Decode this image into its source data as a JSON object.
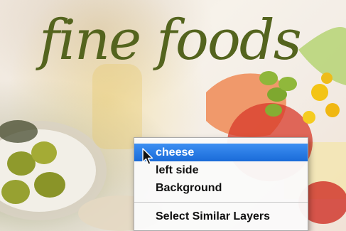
{
  "image": {
    "watermark_text": "fine foods",
    "colors": {
      "watermark": "#54641e",
      "menu_background": "#fafafa",
      "menu_selection": "#2a7ce6",
      "menu_text": "#101010"
    }
  },
  "context_menu": {
    "items": [
      {
        "label": "cheese",
        "selected": true
      },
      {
        "label": "left side",
        "selected": false
      },
      {
        "label": "Background",
        "selected": false
      }
    ],
    "footer_item": {
      "label": "Select Similar Layers"
    }
  },
  "cursor": {
    "icon": "arrow-cursor-icon"
  }
}
